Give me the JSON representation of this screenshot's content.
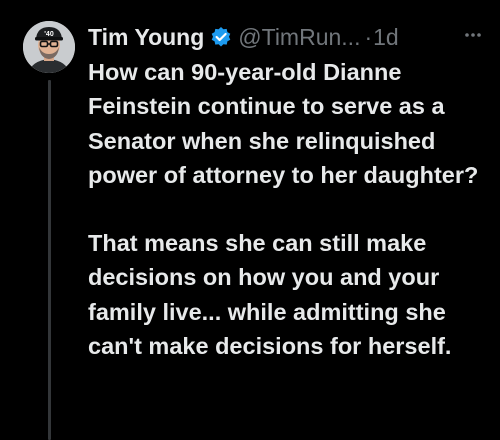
{
  "tweet": {
    "author_name": "Tim Young",
    "verified_icon": "verified-badge-icon",
    "verified_color": "#1d9bf0",
    "handle": "@TimRun...",
    "separator": "·",
    "timestamp": "1d",
    "more_icon": "more-options-icon",
    "avatar_cap_text": "'40",
    "paragraphs": [
      "How can 90-year-old Dianne Feinstein continue to serve as a Senator when she relinquished power of attorney to her daughter?",
      "That means she can still make decisions on how you and your family live... while admitting she can't make decisions for herself."
    ]
  },
  "colors": {
    "background": "#000000",
    "text_primary": "#e7e9ea",
    "text_secondary": "#71767b",
    "thread_line": "#333639"
  }
}
